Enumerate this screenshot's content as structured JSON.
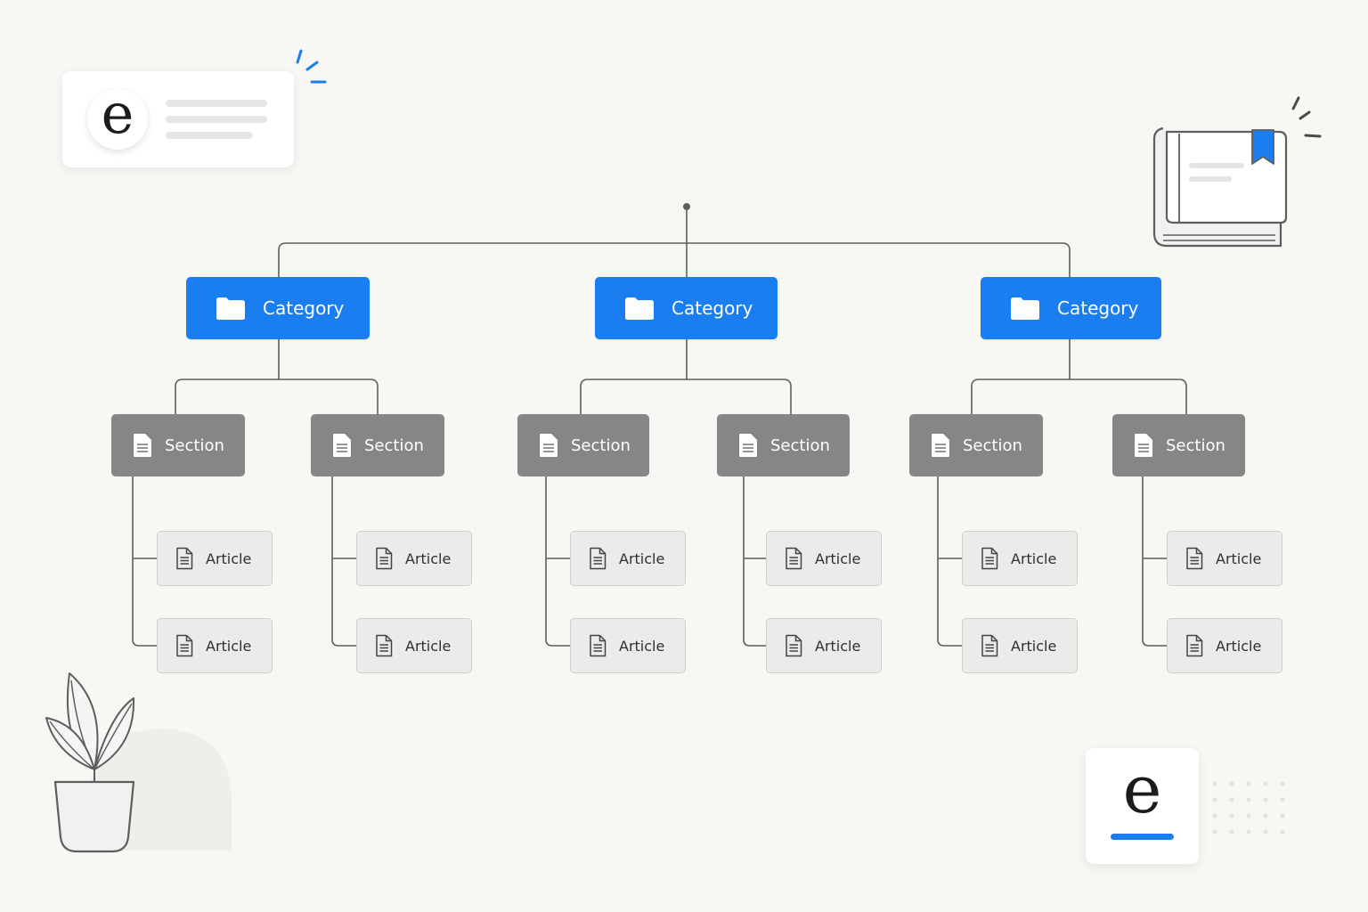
{
  "brand": {
    "logo_letter": "e",
    "accent_color": "#1a7ef1",
    "section_color": "#868686",
    "article_color": "#ebebea"
  },
  "diagram": {
    "categories": [
      {
        "label": "Category",
        "sections": [
          {
            "label": "Section",
            "articles": [
              "Article",
              "Article"
            ]
          },
          {
            "label": "Section",
            "articles": [
              "Article",
              "Article"
            ]
          }
        ]
      },
      {
        "label": "Category",
        "sections": [
          {
            "label": "Section",
            "articles": [
              "Article",
              "Article"
            ]
          },
          {
            "label": "Section",
            "articles": [
              "Article",
              "Article"
            ]
          }
        ]
      },
      {
        "label": "Category",
        "sections": [
          {
            "label": "Section",
            "articles": [
              "Article",
              "Article"
            ]
          },
          {
            "label": "Section",
            "articles": [
              "Article",
              "Article"
            ]
          }
        ]
      }
    ]
  },
  "icons": {
    "category": "folder-icon",
    "section": "document-icon",
    "article": "document-outline-icon",
    "decor": [
      "book-icon",
      "plant-icon",
      "sparkle-icon"
    ]
  }
}
